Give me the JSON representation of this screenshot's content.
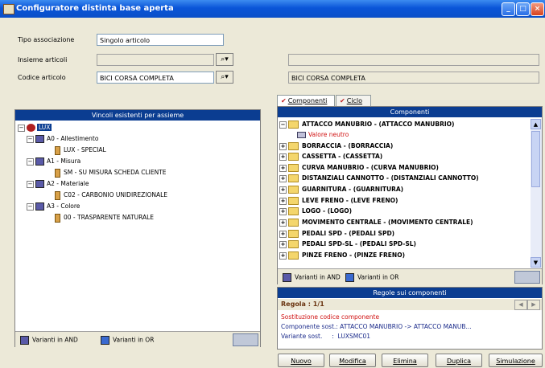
{
  "window": {
    "title": "Configuratore distinta base aperta"
  },
  "form": {
    "tipo_label": "Tipo associazione",
    "tipo_value": "Singolo articolo",
    "insieme_label": "Insieme articoli",
    "insieme_value": "",
    "codice_label": "Codice articolo",
    "codice_value": "BICI CORSA COMPLETA",
    "desc_top": "",
    "desc_value": "BICI CORSA COMPLETA"
  },
  "left_panel": {
    "header": "Vincoli esistenti per assieme",
    "root": "LUX",
    "nodes": [
      {
        "label": "A0 - Allestimento",
        "child": "LUX - SPECIAL"
      },
      {
        "label": "A1 - Misura",
        "child": "SM - SU MISURA SCHEDA CLIENTE"
      },
      {
        "label": "A2 - Materiale",
        "child": "C02 - CARBONIO UNIDIREZIONALE"
      },
      {
        "label": "A3 - Colore",
        "child": "00 - TRASPARENTE NATURALE"
      }
    ],
    "legend_and": "Varianti in AND",
    "legend_or": "Varianti in OR"
  },
  "tabs": {
    "componenti": "Componenti",
    "ciclo": "Ciclo"
  },
  "components": {
    "header": "Componenti",
    "items": [
      "ATTACCO MANUBRIO - (ATTACCO MANUBRIO)",
      "BORRACCIA - (BORRACCIA)",
      "CASSETTA - (CASSETTA)",
      "CURVA MANUBRIO - (CURVA MANUBRIO)",
      "DISTANZIALI CANNOTTO - (DISTANZIALI CANNOTTO)",
      "GUARNITURA - (GUARNITURA)",
      "LEVE FRENO - (LEVE FRENO)",
      "LOGO - (LOGO)",
      "MOVIMENTO CENTRALE - (MOVIMENTO CENTRALE)",
      "PEDALI SPD - (PEDALI SPD)",
      "PEDALI SPD-SL - (PEDALI SPD-SL)",
      "PINZE FRENO - (PINZE FRENO)"
    ],
    "neutral_value": "Valore neutro",
    "legend_and": "Varianti in AND",
    "legend_or": "Varianti in OR"
  },
  "rules": {
    "header": "Regole sui componenti",
    "regola": "Regola : 1/1",
    "line1": "Sostituzione codice componente",
    "line2": "Componente sost.:  ATTACCO MANUBRIO -> ATTACCO MANUB...",
    "line3": "Variante sost.     :  LUXSMC01"
  },
  "buttons": {
    "nuovo": "Nuovo",
    "modifica": "Modifica",
    "elimina": "Elimina",
    "duplica": "Duplica",
    "simulazione": "Simulazione"
  },
  "colors": {
    "title_bar": "#0a55d8",
    "panel_header": "#0b3d91",
    "neutral_red": "#d01010"
  }
}
